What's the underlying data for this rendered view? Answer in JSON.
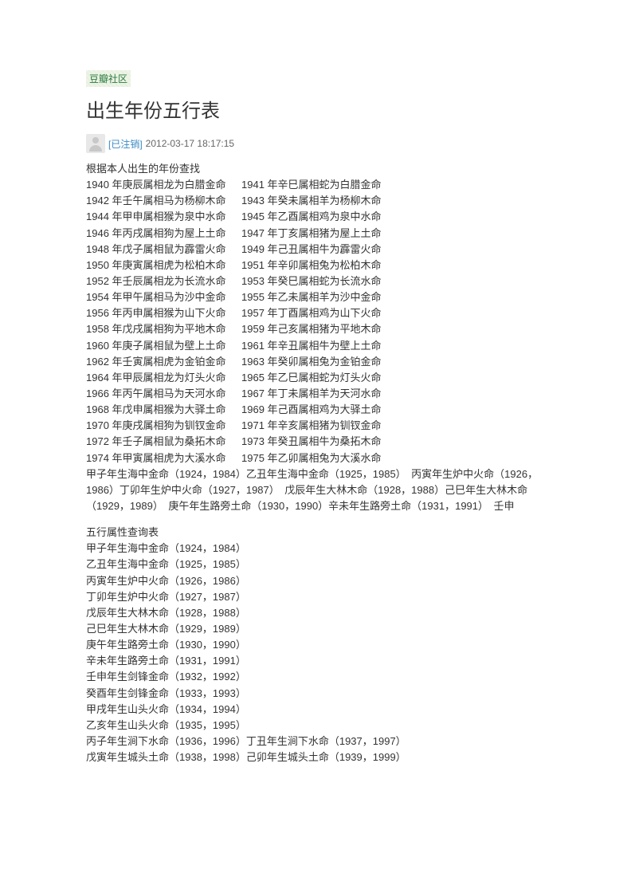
{
  "breadcrumb": "豆瓣社区",
  "title": "出生年份五行表",
  "author_name": "[已注销]",
  "timestamp": "2012-03-17 18:17:15",
  "intro": "根据本人出生的年份查找",
  "year_pairs": [
    [
      "1940 年庚辰属相龙为白腊金命",
      "1941 年辛巳属相蛇为白腊金命"
    ],
    [
      "1942 年壬午属相马为杨柳木命",
      "1943 年癸未属相羊为杨柳木命"
    ],
    [
      "1944 年甲申属相猴为泉中水命",
      "1945 年乙酉属相鸡为泉中水命"
    ],
    [
      "1946 年丙戌属相狗为屋上土命",
      "1947 年丁亥属相猪为屋上土命"
    ],
    [
      "1948 年戊子属相鼠为霹雷火命",
      "1949 年己丑属相牛为霹雷火命"
    ],
    [
      "1950 年庚寅属相虎为松柏木命",
      "1951 年辛卯属相兔为松柏木命"
    ],
    [
      "1952 年壬辰属相龙为长流水命",
      "1953 年癸巳属相蛇为长流水命"
    ],
    [
      "1954 年甲午属相马为沙中金命",
      "1955 年乙未属相羊为沙中金命"
    ],
    [
      "1956 年丙申属相猴为山下火命",
      "1957 年丁酉属相鸡为山下火命"
    ],
    [
      "1958 年戊戌属相狗为平地木命",
      "1959 年己亥属相猪为平地木命"
    ],
    [
      "1960 年庚子属相鼠为壁上土命",
      "1961 年辛丑属相牛为壁上土命"
    ],
    [
      "1962 年壬寅属相虎为金铂金命",
      "1963 年癸卯属相兔为金铂金命"
    ],
    [
      "1964 年甲辰属相龙为灯头火命",
      "1965 年乙巳属相蛇为灯头火命"
    ],
    [
      "1966 年丙午属相马为天河水命",
      "1967 年丁未属相羊为天河水命"
    ],
    [
      "1968 年戊申属相猴为大驿土命",
      "1969 年己酉属相鸡为大驿土命"
    ],
    [
      "1970 年庚戌属相狗为钏钗金命",
      "1971 年辛亥属相猪为钏钗金命"
    ],
    [
      "1972 年壬子属相鼠为桑拓木命",
      "1973 年癸丑属相牛为桑拓木命"
    ],
    [
      "1974 年甲寅属相虎为大溪水命",
      "1975 年乙卯属相兔为大溪水命"
    ]
  ],
  "paragraph1": "甲子年生海中金命（1924，1984）乙丑年生海中金命（1925，1985）　丙寅年生炉中火命（1926，1986）丁卯年生炉中火命（1927，1987）　戊辰年生大林木命（1928，1988）己巳年生大林木命（1929，1989）　庚午年生路旁土命（1930，1990）辛未年生路旁土命（1931，1991）　壬申",
  "subtitle": "五行属性查询表",
  "list2": [
    "甲子年生海中金命（1924，1984）",
    "乙丑年生海中金命（1925，1985）",
    "丙寅年生炉中火命（1926，1986）",
    "丁卯年生炉中火命（1927，1987）",
    "戊辰年生大林木命（1928，1988）",
    "己巳年生大林木命（1929，1989）",
    "庚午年生路旁土命（1930，1990）",
    "辛未年生路旁土命（1931，1991）",
    "壬申年生剑锋金命（1932，1992）",
    "癸酉年生剑锋金命（1933，1993）",
    "甲戌年生山头火命（1934，1994）",
    "乙亥年生山头火命（1935，1995）",
    "丙子年生涧下水命（1936，1996）丁丑年生涧下水命（1937，1997）",
    "戊寅年生城头土命（1938，1998）己卯年生城头土命（1939，1999）"
  ]
}
